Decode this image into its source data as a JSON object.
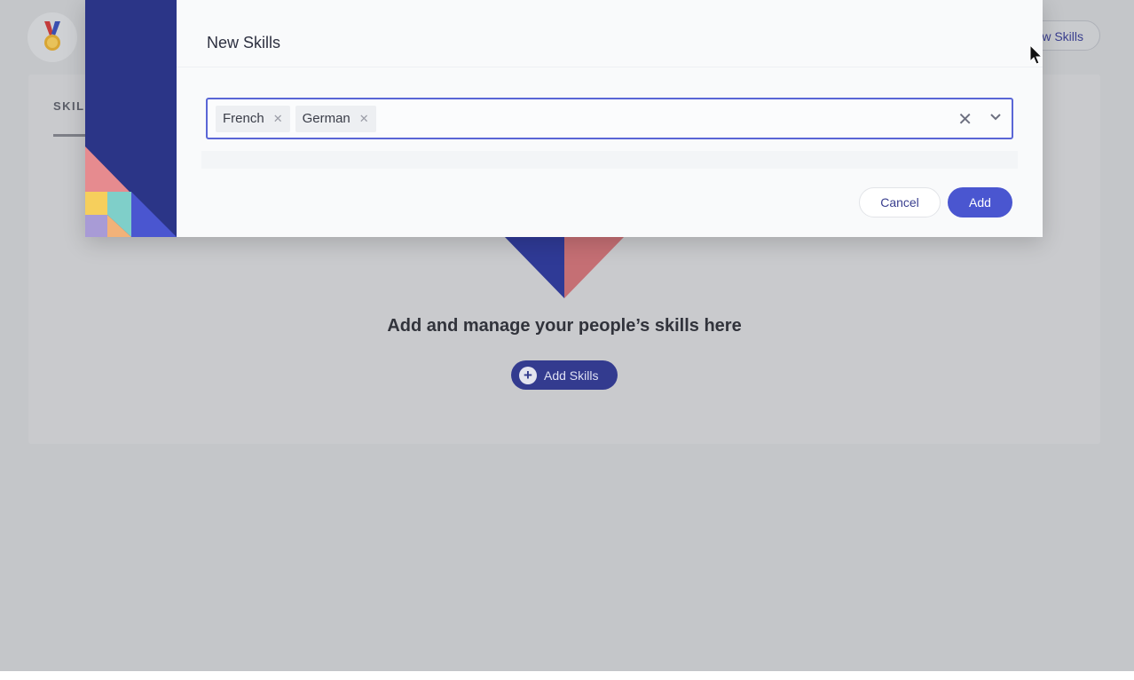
{
  "header": {
    "logo_icon": "medal-icon",
    "new_skills_label": "w Skills"
  },
  "page": {
    "tab_label": "SKILL",
    "empty_state_title": "Add and manage your people’s skills here",
    "add_skills_label": "Add Skills"
  },
  "modal": {
    "title": "New Skills",
    "selected_skills": [
      "French",
      "German"
    ],
    "cancel_label": "Cancel",
    "add_label": "Add"
  },
  "colors": {
    "primary": "#4a56d0",
    "navy": "#2b3587",
    "coral": "#e68b8f",
    "teal": "#7fcfc9",
    "yellow": "#f6cf5c",
    "lavender": "#a89bd6"
  }
}
